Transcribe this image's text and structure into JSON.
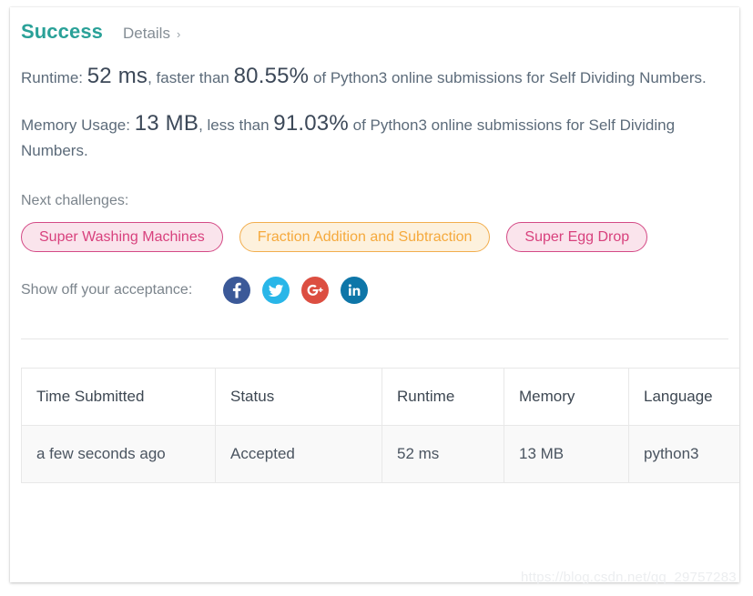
{
  "card": {
    "status_title": "Success",
    "details_label": "Details",
    "details_chevron": "›"
  },
  "stats": {
    "runtime": {
      "prefix": "Runtime: ",
      "value": "52 ms",
      "mid": ", faster than ",
      "percent": "80.55%",
      "suffix": " of Python3 online submissions for Self Dividing Numbers."
    },
    "memory": {
      "prefix": "Memory Usage: ",
      "value": "13 MB",
      "mid": ", less than ",
      "percent": "91.03%",
      "suffix": " of Python3 online submissions for Self Dividing Numbers."
    }
  },
  "next_challenges": {
    "label": "Next challenges:",
    "tags": [
      {
        "label": "Super Washing Machines",
        "style": "pink"
      },
      {
        "label": "Fraction Addition and Subtraction",
        "style": "orange"
      },
      {
        "label": "Super Egg Drop",
        "style": "pink"
      }
    ]
  },
  "share": {
    "label": "Show off your acceptance:",
    "icons": [
      {
        "name": "facebook-share-icon",
        "glyph": "f",
        "color": "#3b5998"
      },
      {
        "name": "twitter-share-icon",
        "glyph": "t",
        "color": "#29b6e8"
      },
      {
        "name": "googleplus-share-icon",
        "glyph": "G+",
        "color": "#dc4e41"
      },
      {
        "name": "linkedin-share-icon",
        "glyph": "in",
        "color": "#0e76a8"
      }
    ]
  },
  "submissions_table": {
    "headers": [
      "Time Submitted",
      "Status",
      "Runtime",
      "Memory",
      "Language"
    ],
    "rows": [
      {
        "time_submitted": "a few seconds ago",
        "status": "Accepted",
        "runtime": "52 ms",
        "memory": "13 MB",
        "language": "python3"
      }
    ]
  },
  "watermark": "https://blog.csdn.net/qq_29757283",
  "colors": {
    "success_teal": "#2aa198",
    "accepted_teal": "#18a197",
    "tag_pink_text": "#d8417d",
    "tag_pink_bg": "#fae4ec",
    "tag_pink_border": "#d44a86",
    "tag_orange_text": "#f5a93c",
    "tag_orange_bg": "#fdf1dd",
    "tag_orange_border": "#f2ae4e",
    "body_text": "#5c6b7a"
  }
}
